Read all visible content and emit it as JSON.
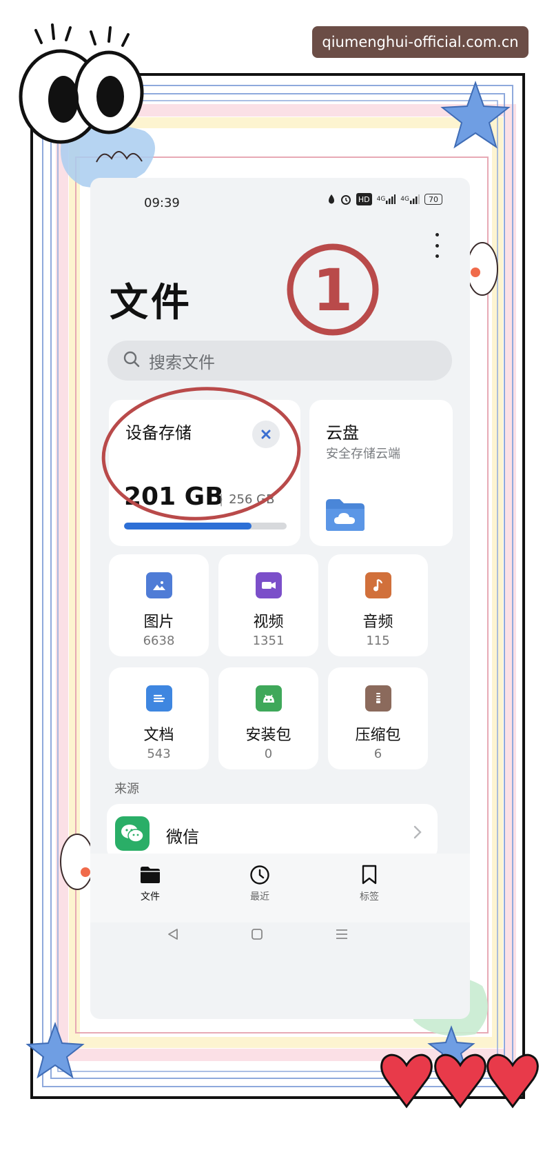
{
  "watermark": "qiumenghui-official.com.cn",
  "status_bar": {
    "time": "09:39",
    "network_badge": "HD",
    "signal_1": "4G",
    "signal_2": "4G",
    "battery": "70"
  },
  "header": {
    "title": "文件"
  },
  "search": {
    "placeholder": "搜索文件"
  },
  "storage": {
    "title": "设备存储",
    "used": "201 GB",
    "total": "256 GB",
    "used_fraction": 0.785
  },
  "cloud": {
    "title": "云盘",
    "subtitle": "安全存储云端"
  },
  "categories": [
    {
      "label": "图片",
      "count": "6638",
      "color": "#4f7cd6",
      "icon": "image-icon"
    },
    {
      "label": "视频",
      "count": "1351",
      "color": "#7b4fc9",
      "icon": "video-icon"
    },
    {
      "label": "音频",
      "count": "115",
      "color": "#d1703b",
      "icon": "music-icon"
    },
    {
      "label": "文档",
      "count": "543",
      "color": "#3e86e0",
      "icon": "document-icon"
    },
    {
      "label": "安装包",
      "count": "0",
      "color": "#3fa85a",
      "icon": "android-icon"
    },
    {
      "label": "压缩包",
      "count": "6",
      "color": "#8b6a5c",
      "icon": "archive-icon"
    }
  ],
  "sources": {
    "section_label": "来源",
    "items": [
      {
        "label": "微信",
        "icon": "wechat-icon"
      }
    ]
  },
  "bottom_nav": [
    {
      "label": "文件",
      "icon": "folder-icon",
      "active": true
    },
    {
      "label": "最近",
      "icon": "clock-icon",
      "active": false
    },
    {
      "label": "标签",
      "icon": "bookmark-icon",
      "active": false
    }
  ],
  "annotation": {
    "number": "1",
    "color": "#b94a4a"
  },
  "colors": {
    "accent": "#2d6fd6",
    "annotation_red": "#b94a4a",
    "frame_blue": "#7b9ad6"
  }
}
